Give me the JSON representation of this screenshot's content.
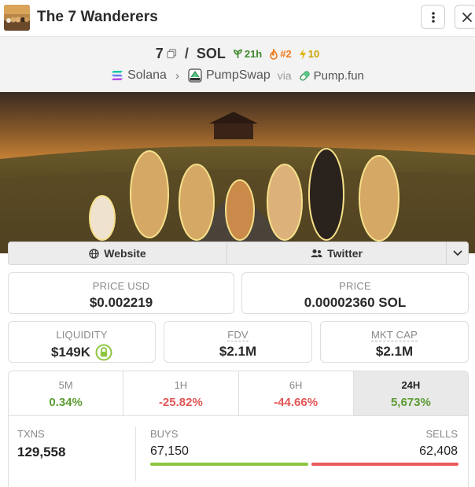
{
  "header": {
    "title": "The 7 Wanderers",
    "avatar_icon": "token-avatar",
    "more_icon": "more-vertical-icon",
    "close_icon": "close-icon"
  },
  "pair": {
    "base": "7",
    "quote": "SOL",
    "separator": "/",
    "age": "21h",
    "rank": "#2",
    "boosts": "10"
  },
  "chain": {
    "chain": "Solana",
    "dex": "PumpSwap",
    "via_label": "via",
    "launchpad": "Pump.fun"
  },
  "links": {
    "website": "Website",
    "twitter": "Twitter"
  },
  "stats": {
    "price_usd_label": "PRICE USD",
    "price_usd": "$0.002219",
    "price_label": "PRICE",
    "price_native": "0.00002360 SOL",
    "liquidity_label": "LIQUIDITY",
    "liquidity": "$149K",
    "fdv_label": "FDV",
    "fdv": "$2.1M",
    "mktcap_label": "MKT CAP",
    "mktcap": "$2.1M"
  },
  "timeframes": [
    {
      "label": "5M",
      "value": "0.34%",
      "trend": "up"
    },
    {
      "label": "1H",
      "value": "-25.82%",
      "trend": "down"
    },
    {
      "label": "6H",
      "value": "-44.66%",
      "trend": "down"
    },
    {
      "label": "24H",
      "value": "5,673%",
      "trend": "up",
      "active": true
    }
  ],
  "txns": {
    "txns_label": "TXNS",
    "txns": "129,558",
    "buys_label": "BUYS",
    "buys": "67,150",
    "sells_label": "SELLS",
    "sells": "62,408",
    "buy_share": 0.518
  },
  "colors": {
    "positive": "#5c9b33",
    "negative": "#e25555",
    "buy_bar": "#8cc63f",
    "sell_bar": "#ea5a5a"
  }
}
